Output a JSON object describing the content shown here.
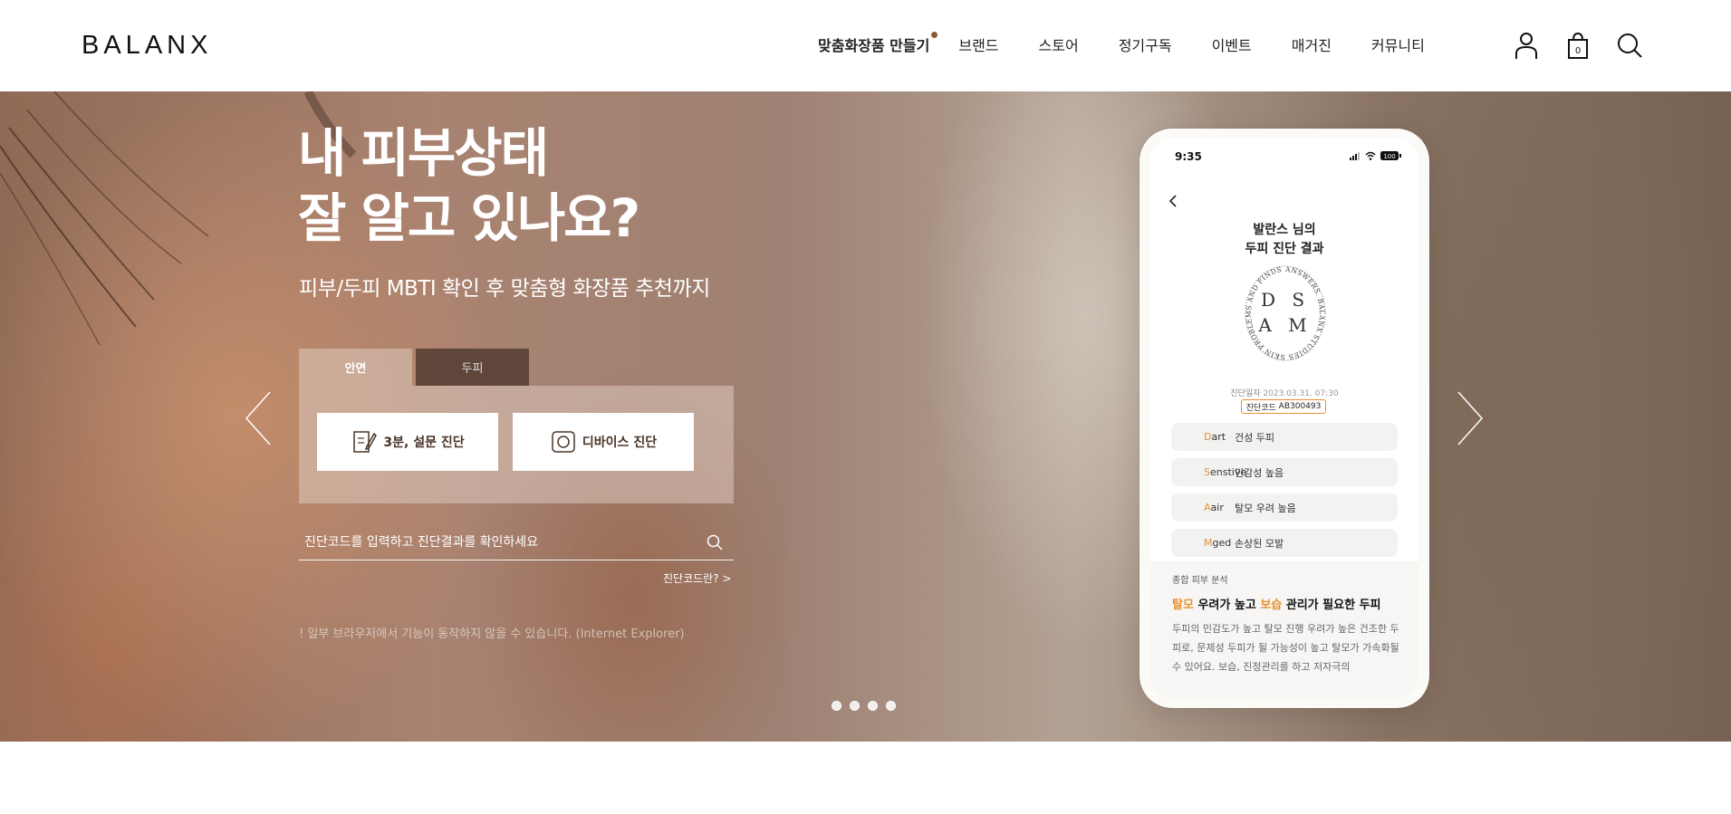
{
  "header": {
    "logo": "BALANX",
    "nav": [
      "맞춤화장품 만들기",
      "브랜드",
      "스토어",
      "정기구독",
      "이벤트",
      "매거진",
      "커뮤니티"
    ],
    "cart_count": "0",
    "icons": [
      "user-icon",
      "bag-icon",
      "search-icon"
    ]
  },
  "hero": {
    "title_line1": "내 피부상태",
    "title_line2": "잘 알고 있나요?",
    "subtitle": "피부/두피 MBTI 확인 후 맞춤형 화장품 추천까지",
    "tabs": [
      "안면",
      "두피"
    ],
    "buttons": [
      "3분, 설문 진단",
      "디바이스 진단"
    ],
    "search_placeholder": "진단코드를 입력하고 진단결과를 확인하세요",
    "code_link": "진단코드란? >",
    "notice": "! 일부 브라우저에서 기능이 동작하지 않을 수 있습니다. (Internet Explorer)",
    "slide_count": 4
  },
  "phone": {
    "time": "9:35",
    "battery": "100",
    "result_title_1": "발란스 님의",
    "result_title_2": "두피 진단 결과",
    "seal_text": "ANSWERS. BALANX STUDIES SKIN PROBLEMS AND FINDS",
    "seal_line1": "D S",
    "seal_line2": "A M",
    "date_label": "진단일자",
    "date_value": "2023.03.31. 07:30",
    "code_label": "진단코드",
    "code_value": "AB300493",
    "rows": [
      {
        "initial": "D",
        "rest": "art",
        "value": "건성 두피"
      },
      {
        "initial": "S",
        "rest": "enstive",
        "value": "민감성 높음"
      },
      {
        "initial": "A",
        "rest": "air",
        "value": "탈모 우려 높음"
      },
      {
        "initial": "M",
        "rest": "ged",
        "value": "손상된 모발"
      }
    ],
    "analysis_label": "종합 피부 분석",
    "analysis_head_1": "탈모",
    "analysis_head_2": " 우려가 높고 ",
    "analysis_head_3": "보습",
    "analysis_head_4": " 관리가 필요한 두피",
    "analysis_body": "두피의 민감도가 높고 탈모 진행 우려가 높은 건조한 두피로, 문제성 두피가 될 가능성이 높고 탈모가 가속화될 수 있어요. 보습, 진정관리를 하고 저자극의"
  },
  "colors": {
    "accent": "#e8912e",
    "brand_dark": "#4a3326",
    "nav_dot": "#8a5a3a"
  }
}
